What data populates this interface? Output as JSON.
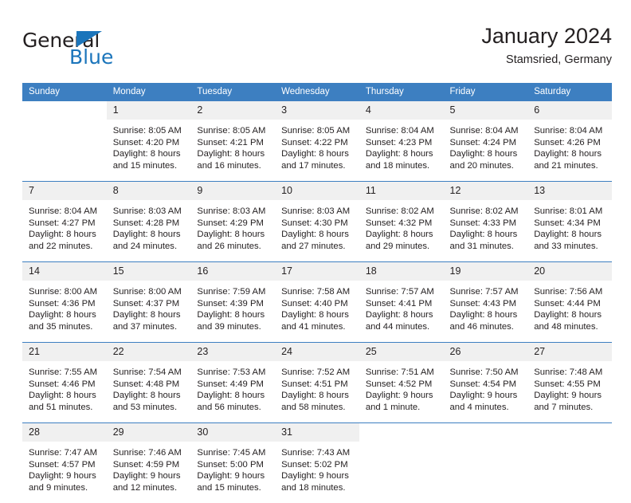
{
  "brand": {
    "name_part1": "General",
    "name_part2": "Blue",
    "triangle_icon": "triangle-icon",
    "accent_color": "#1b75bb"
  },
  "header": {
    "title": "January 2024",
    "subtitle": "Stamsried, Germany",
    "header_bg_color": "#3d7fc1",
    "daynum_bg_color": "#f0f0f0"
  },
  "weekdays": [
    "Sunday",
    "Monday",
    "Tuesday",
    "Wednesday",
    "Thursday",
    "Friday",
    "Saturday"
  ],
  "weeks": [
    [
      {
        "day": "",
        "lines": []
      },
      {
        "day": "1",
        "lines": [
          "Sunrise: 8:05 AM",
          "Sunset: 4:20 PM",
          "Daylight: 8 hours",
          "and 15 minutes."
        ]
      },
      {
        "day": "2",
        "lines": [
          "Sunrise: 8:05 AM",
          "Sunset: 4:21 PM",
          "Daylight: 8 hours",
          "and 16 minutes."
        ]
      },
      {
        "day": "3",
        "lines": [
          "Sunrise: 8:05 AM",
          "Sunset: 4:22 PM",
          "Daylight: 8 hours",
          "and 17 minutes."
        ]
      },
      {
        "day": "4",
        "lines": [
          "Sunrise: 8:04 AM",
          "Sunset: 4:23 PM",
          "Daylight: 8 hours",
          "and 18 minutes."
        ]
      },
      {
        "day": "5",
        "lines": [
          "Sunrise: 8:04 AM",
          "Sunset: 4:24 PM",
          "Daylight: 8 hours",
          "and 20 minutes."
        ]
      },
      {
        "day": "6",
        "lines": [
          "Sunrise: 8:04 AM",
          "Sunset: 4:26 PM",
          "Daylight: 8 hours",
          "and 21 minutes."
        ]
      }
    ],
    [
      {
        "day": "7",
        "lines": [
          "Sunrise: 8:04 AM",
          "Sunset: 4:27 PM",
          "Daylight: 8 hours",
          "and 22 minutes."
        ]
      },
      {
        "day": "8",
        "lines": [
          "Sunrise: 8:03 AM",
          "Sunset: 4:28 PM",
          "Daylight: 8 hours",
          "and 24 minutes."
        ]
      },
      {
        "day": "9",
        "lines": [
          "Sunrise: 8:03 AM",
          "Sunset: 4:29 PM",
          "Daylight: 8 hours",
          "and 26 minutes."
        ]
      },
      {
        "day": "10",
        "lines": [
          "Sunrise: 8:03 AM",
          "Sunset: 4:30 PM",
          "Daylight: 8 hours",
          "and 27 minutes."
        ]
      },
      {
        "day": "11",
        "lines": [
          "Sunrise: 8:02 AM",
          "Sunset: 4:32 PM",
          "Daylight: 8 hours",
          "and 29 minutes."
        ]
      },
      {
        "day": "12",
        "lines": [
          "Sunrise: 8:02 AM",
          "Sunset: 4:33 PM",
          "Daylight: 8 hours",
          "and 31 minutes."
        ]
      },
      {
        "day": "13",
        "lines": [
          "Sunrise: 8:01 AM",
          "Sunset: 4:34 PM",
          "Daylight: 8 hours",
          "and 33 minutes."
        ]
      }
    ],
    [
      {
        "day": "14",
        "lines": [
          "Sunrise: 8:00 AM",
          "Sunset: 4:36 PM",
          "Daylight: 8 hours",
          "and 35 minutes."
        ]
      },
      {
        "day": "15",
        "lines": [
          "Sunrise: 8:00 AM",
          "Sunset: 4:37 PM",
          "Daylight: 8 hours",
          "and 37 minutes."
        ]
      },
      {
        "day": "16",
        "lines": [
          "Sunrise: 7:59 AM",
          "Sunset: 4:39 PM",
          "Daylight: 8 hours",
          "and 39 minutes."
        ]
      },
      {
        "day": "17",
        "lines": [
          "Sunrise: 7:58 AM",
          "Sunset: 4:40 PM",
          "Daylight: 8 hours",
          "and 41 minutes."
        ]
      },
      {
        "day": "18",
        "lines": [
          "Sunrise: 7:57 AM",
          "Sunset: 4:41 PM",
          "Daylight: 8 hours",
          "and 44 minutes."
        ]
      },
      {
        "day": "19",
        "lines": [
          "Sunrise: 7:57 AM",
          "Sunset: 4:43 PM",
          "Daylight: 8 hours",
          "and 46 minutes."
        ]
      },
      {
        "day": "20",
        "lines": [
          "Sunrise: 7:56 AM",
          "Sunset: 4:44 PM",
          "Daylight: 8 hours",
          "and 48 minutes."
        ]
      }
    ],
    [
      {
        "day": "21",
        "lines": [
          "Sunrise: 7:55 AM",
          "Sunset: 4:46 PM",
          "Daylight: 8 hours",
          "and 51 minutes."
        ]
      },
      {
        "day": "22",
        "lines": [
          "Sunrise: 7:54 AM",
          "Sunset: 4:48 PM",
          "Daylight: 8 hours",
          "and 53 minutes."
        ]
      },
      {
        "day": "23",
        "lines": [
          "Sunrise: 7:53 AM",
          "Sunset: 4:49 PM",
          "Daylight: 8 hours",
          "and 56 minutes."
        ]
      },
      {
        "day": "24",
        "lines": [
          "Sunrise: 7:52 AM",
          "Sunset: 4:51 PM",
          "Daylight: 8 hours",
          "and 58 minutes."
        ]
      },
      {
        "day": "25",
        "lines": [
          "Sunrise: 7:51 AM",
          "Sunset: 4:52 PM",
          "Daylight: 9 hours",
          "and 1 minute."
        ]
      },
      {
        "day": "26",
        "lines": [
          "Sunrise: 7:50 AM",
          "Sunset: 4:54 PM",
          "Daylight: 9 hours",
          "and 4 minutes."
        ]
      },
      {
        "day": "27",
        "lines": [
          "Sunrise: 7:48 AM",
          "Sunset: 4:55 PM",
          "Daylight: 9 hours",
          "and 7 minutes."
        ]
      }
    ],
    [
      {
        "day": "28",
        "lines": [
          "Sunrise: 7:47 AM",
          "Sunset: 4:57 PM",
          "Daylight: 9 hours",
          "and 9 minutes."
        ]
      },
      {
        "day": "29",
        "lines": [
          "Sunrise: 7:46 AM",
          "Sunset: 4:59 PM",
          "Daylight: 9 hours",
          "and 12 minutes."
        ]
      },
      {
        "day": "30",
        "lines": [
          "Sunrise: 7:45 AM",
          "Sunset: 5:00 PM",
          "Daylight: 9 hours",
          "and 15 minutes."
        ]
      },
      {
        "day": "31",
        "lines": [
          "Sunrise: 7:43 AM",
          "Sunset: 5:02 PM",
          "Daylight: 9 hours",
          "and 18 minutes."
        ]
      },
      {
        "day": "",
        "lines": []
      },
      {
        "day": "",
        "lines": []
      },
      {
        "day": "",
        "lines": []
      }
    ]
  ]
}
